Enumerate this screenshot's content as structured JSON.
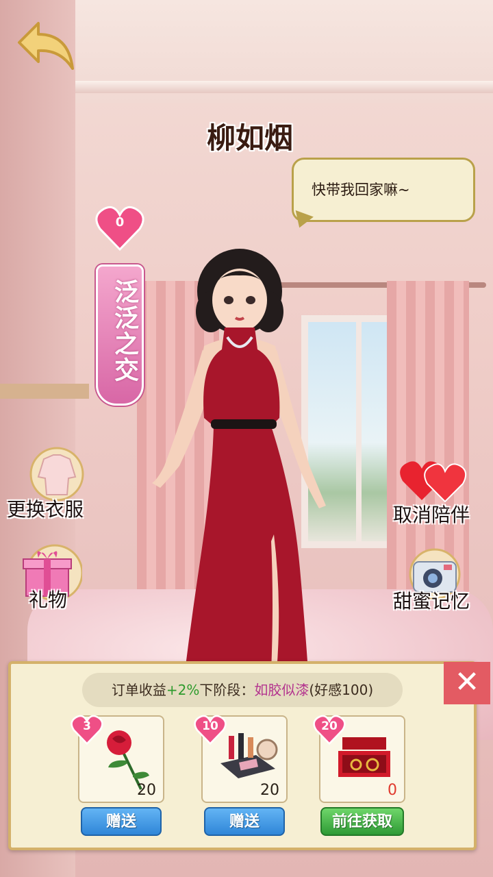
{
  "character": {
    "name": "柳如烟",
    "speech": "快带我回家嘛~"
  },
  "affection": {
    "value": "0",
    "level": "泛泛之交"
  },
  "side_actions": {
    "change_outfit": "更换衣服",
    "gift": "礼物",
    "cancel_companion": "取消陪伴",
    "sweet_memory": "甜蜜记忆"
  },
  "panel": {
    "stage_prefix": "订单收益",
    "stage_bonus": "+2%",
    "stage_middle": "下阶段：",
    "stage_next": "如胶似漆",
    "stage_suffix": "(好感100)",
    "items": [
      {
        "icon": "rose-icon",
        "affection": "3",
        "count": "20",
        "button": "赠送"
      },
      {
        "icon": "cosmetics-icon",
        "affection": "10",
        "count": "20",
        "button": "赠送"
      },
      {
        "icon": "jewelry-box-icon",
        "affection": "20",
        "count": "0",
        "button": "前往获取"
      }
    ]
  },
  "colors": {
    "panel": "#f6efd3",
    "close": "#e35b63",
    "heart": "#ef4f86",
    "ribbon": "#d867a6"
  }
}
